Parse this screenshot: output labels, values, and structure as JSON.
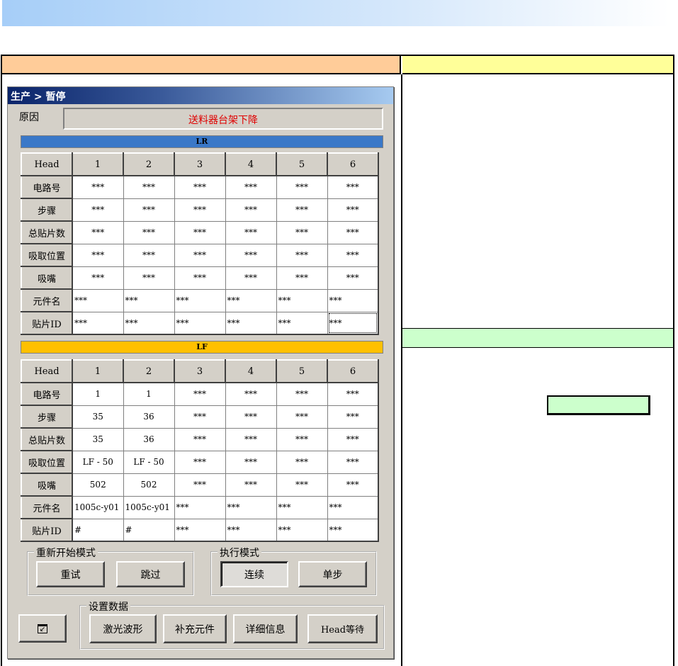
{
  "window": {
    "title": "生产 > 暂停",
    "reason_label": "原因",
    "reason_value": "送料器台架下降",
    "reason_color": "#e00000"
  },
  "lr": {
    "label": "LR",
    "color": "#3a78c8",
    "columns": [
      "Head",
      "1",
      "2",
      "3",
      "4",
      "5",
      "6"
    ],
    "rows": [
      {
        "label": "电路号",
        "values": [
          "***",
          "***",
          "***",
          "***",
          "***",
          "***"
        ]
      },
      {
        "label": "步骤",
        "values": [
          "***",
          "***",
          "***",
          "***",
          "***",
          "***"
        ]
      },
      {
        "label": "总贴片数",
        "values": [
          "***",
          "***",
          "***",
          "***",
          "***",
          "***"
        ]
      },
      {
        "label": "吸取位置",
        "values": [
          "***",
          "***",
          "***",
          "***",
          "***",
          "***"
        ]
      },
      {
        "label": "吸嘴",
        "values": [
          "***",
          "***",
          "***",
          "***",
          "***",
          "***"
        ]
      },
      {
        "label": "元件名",
        "values": [
          "***",
          "***",
          "***",
          "***",
          "***",
          "***"
        ],
        "left": true
      },
      {
        "label": "贴片ID",
        "values": [
          "***",
          "***",
          "***",
          "***",
          "***",
          "***"
        ],
        "left": true
      }
    ]
  },
  "lf": {
    "label": "LF",
    "color": "#ffc000",
    "columns": [
      "Head",
      "1",
      "2",
      "3",
      "4",
      "5",
      "6"
    ],
    "rows": [
      {
        "label": "电路号",
        "values": [
          "1",
          "1",
          "***",
          "***",
          "***",
          "***"
        ]
      },
      {
        "label": "步骤",
        "values": [
          "35",
          "36",
          "***",
          "***",
          "***",
          "***"
        ]
      },
      {
        "label": "总贴片数",
        "values": [
          "35",
          "36",
          "***",
          "***",
          "***",
          "***"
        ]
      },
      {
        "label": "吸取位置",
        "values": [
          "LF - 50",
          "LF - 50",
          "***",
          "***",
          "***",
          "***"
        ]
      },
      {
        "label": "吸嘴",
        "values": [
          "502",
          "502",
          "***",
          "***",
          "***",
          "***"
        ]
      },
      {
        "label": "元件名",
        "values": [
          "1005c-y01",
          "1005c-y01",
          "***",
          "***",
          "***",
          "***"
        ],
        "left": true
      },
      {
        "label": "贴片ID",
        "values": [
          "#",
          "#",
          "***",
          "***",
          "***",
          "***"
        ],
        "left": true
      }
    ]
  },
  "restart_mode": {
    "label": "重新开始模式",
    "retry": "重试",
    "skip": "跳过"
  },
  "exec_mode": {
    "label": "执行模式",
    "continuous": "连续",
    "step": "单步"
  },
  "setup_data": {
    "label": "设置数据",
    "buttons": [
      "激光波形",
      "补充元件",
      "详细信息",
      "Head等待"
    ]
  },
  "icons": {
    "minimize": "minimize-window-icon"
  }
}
